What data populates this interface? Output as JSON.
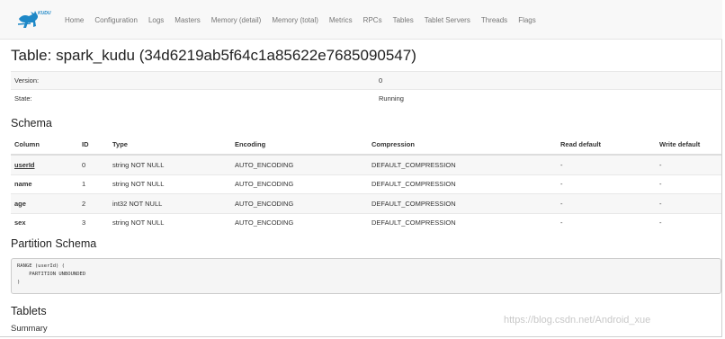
{
  "nav": {
    "items": [
      "Home",
      "Configuration",
      "Logs",
      "Masters",
      "Memory (detail)",
      "Memory (total)",
      "Metrics",
      "RPCs",
      "Tables",
      "Tablet Servers",
      "Threads",
      "Flags"
    ]
  },
  "page": {
    "title": "Table: spark_kudu (34d6219ab5f64c1a85622e7685090547)"
  },
  "info": {
    "rows": [
      {
        "key": "Version:",
        "value": "0"
      },
      {
        "key": "State:",
        "value": "Running"
      }
    ]
  },
  "schema": {
    "title": "Schema",
    "headers": [
      "Column",
      "ID",
      "Type",
      "Encoding",
      "Compression",
      "Read default",
      "Write default"
    ],
    "rows": [
      [
        "userId",
        "0",
        "string NOT NULL",
        "AUTO_ENCODING",
        "DEFAULT_COMPRESSION",
        "-",
        "-"
      ],
      [
        "name",
        "1",
        "string NOT NULL",
        "AUTO_ENCODING",
        "DEFAULT_COMPRESSION",
        "-",
        "-"
      ],
      [
        "age",
        "2",
        "int32 NOT NULL",
        "AUTO_ENCODING",
        "DEFAULT_COMPRESSION",
        "-",
        "-"
      ],
      [
        "sex",
        "3",
        "string NOT NULL",
        "AUTO_ENCODING",
        "DEFAULT_COMPRESSION",
        "-",
        "-"
      ]
    ]
  },
  "partition": {
    "title": "Partition Schema",
    "lines": [
      "RANGE (userId) (",
      "    PARTITION UNBOUNDED",
      ")"
    ]
  },
  "tablets": {
    "title": "Tablets",
    "summary_label": "Summary"
  },
  "watermark": "https://blog.csdn.net/Android_xue",
  "colors": {
    "navbar_bg": "#f8f8f8",
    "logo_blue": "#1e88c7",
    "stripe": "#f7f7f7"
  }
}
